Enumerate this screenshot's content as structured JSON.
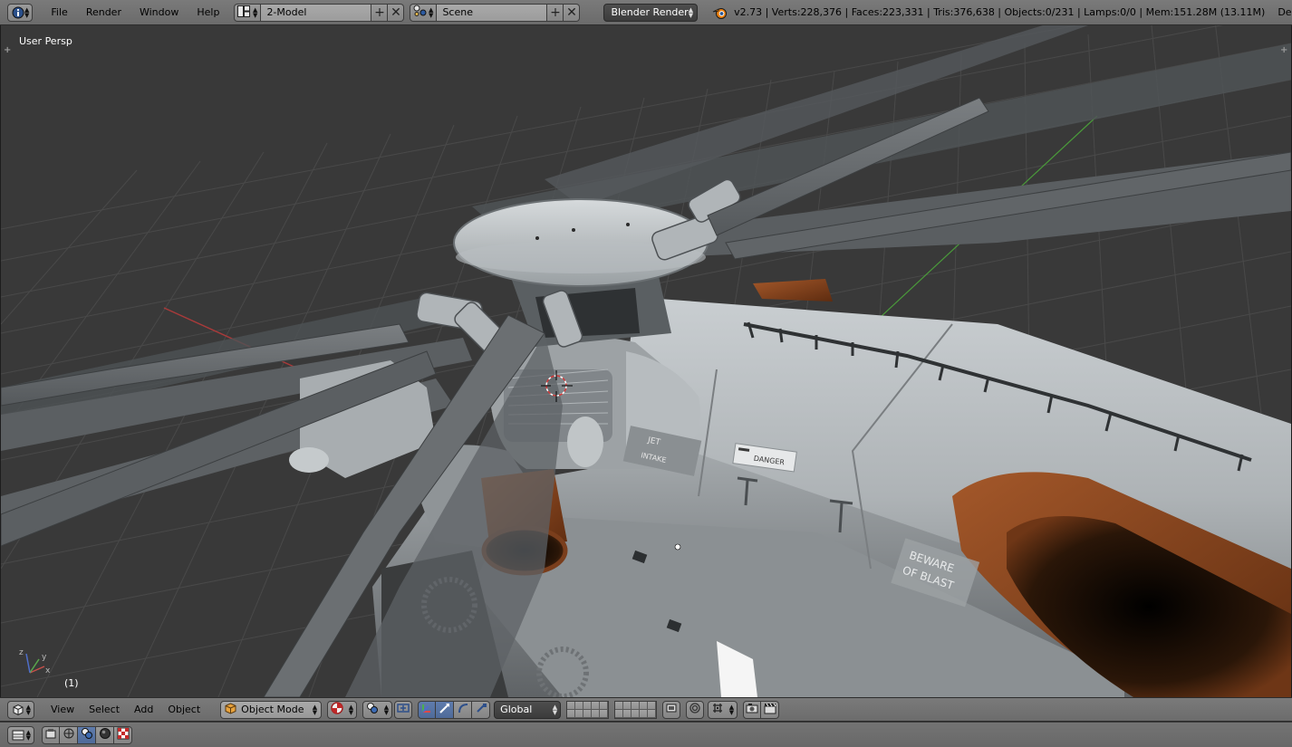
{
  "topbar": {
    "editor_icon": "info-icon",
    "menus": [
      "File",
      "Render",
      "Window",
      "Help"
    ],
    "screen_layout": "2-Model",
    "scene": "Scene",
    "render_engine": "Blender Render",
    "stats": "v2.73 | Verts:228,376 | Faces:223,331 | Tris:376,638 | Objects:0/231 | Lamps:0/0 | Mem:151.28M (13.11M)",
    "file_name": "Demo"
  },
  "viewport": {
    "view_name": "User Persp",
    "frame": "(1)",
    "decals": {
      "jet": "JET",
      "intake": "INTAKE",
      "danger": "DANGER",
      "beware_line1": "BEWARE",
      "beware_line2": "OF BLAST"
    },
    "axis_labels": {
      "x": "x",
      "y": "y",
      "z": "z"
    },
    "colors": {
      "background": "#393939",
      "grid": "#4a4a4a",
      "x_axis": "#a83a3a",
      "y_axis": "#4a9a3a",
      "hull": "#b8bdc0",
      "exhaust": "#7a3e1c"
    }
  },
  "view_header": {
    "editor_icon": "3d-view-icon",
    "menus": [
      "View",
      "Select",
      "Add",
      "Object"
    ],
    "mode": "Object Mode",
    "orientation": "Global"
  },
  "timeline": {
    "editor_icon": "timeline-icon"
  }
}
